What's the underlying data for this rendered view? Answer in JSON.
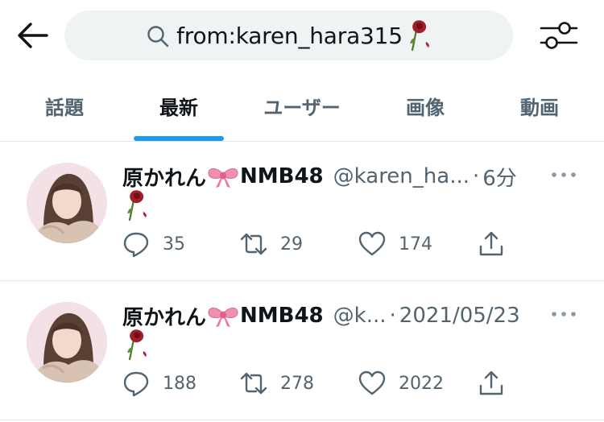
{
  "search": {
    "query": "from:karen_hara315"
  },
  "icons": {
    "back": "arrow-left-icon",
    "search": "search-icon",
    "filter": "sliders-icon",
    "rose": "wilted-rose-emoji",
    "bow": "ribbon-emoji",
    "more": "more-horizontal-icon",
    "reply": "reply-icon",
    "retweet": "retweet-icon",
    "like": "heart-icon",
    "share": "share-icon"
  },
  "tabs": [
    {
      "label": "話題"
    },
    {
      "label": "最新"
    },
    {
      "label": "ユーザー"
    },
    {
      "label": "画像"
    },
    {
      "label": "動画"
    }
  ],
  "active_tab": "最新",
  "colors": {
    "accent": "#1d9bf0",
    "text_primary": "#0f1419",
    "text_secondary": "#536471",
    "search_bg": "#eff3f4"
  },
  "tweets": [
    {
      "name_prefix": "原かれん",
      "name_suffix": "NMB48",
      "handle": "@karen_ha...",
      "separator": "·",
      "time": "6分",
      "replies": "35",
      "retweets": "29",
      "likes": "174"
    },
    {
      "name_prefix": "原かれん",
      "name_suffix": "NMB48",
      "handle": "@k...",
      "separator": "·",
      "time": "2021/05/23",
      "replies": "188",
      "retweets": "278",
      "likes": "2022"
    }
  ]
}
